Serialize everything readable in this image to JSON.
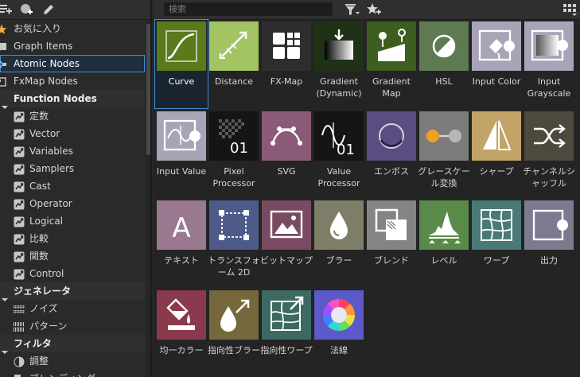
{
  "left_toolbar": {
    "icons": [
      "add-library-icon",
      "add-item-icon",
      "edit-icon"
    ]
  },
  "library": {
    "items": [
      {
        "label": "お気に入り",
        "icon": "star-icon",
        "kind": "lib"
      },
      {
        "label": "Graph Items",
        "icon": "graph-items-icon",
        "kind": "lib"
      },
      {
        "label": "Atomic Nodes",
        "icon": "atomic-nodes-icon",
        "kind": "lib",
        "selected": true
      },
      {
        "label": "FxMap Nodes",
        "icon": "fxmap-nodes-icon",
        "kind": "lib"
      },
      {
        "label": "Function Nodes",
        "icon": "collapse-arrow-icon",
        "kind": "section"
      },
      {
        "label": "定数",
        "icon": "function-icon",
        "kind": "sub"
      },
      {
        "label": "Vector",
        "icon": "function-icon",
        "kind": "sub"
      },
      {
        "label": "Variables",
        "icon": "function-icon",
        "kind": "sub"
      },
      {
        "label": "Samplers",
        "icon": "function-icon",
        "kind": "sub"
      },
      {
        "label": "Cast",
        "icon": "function-icon",
        "kind": "sub"
      },
      {
        "label": "Operator",
        "icon": "function-icon",
        "kind": "sub"
      },
      {
        "label": "Logical",
        "icon": "function-icon",
        "kind": "sub"
      },
      {
        "label": "比較",
        "icon": "function-icon",
        "kind": "sub"
      },
      {
        "label": "関数",
        "icon": "function-icon",
        "kind": "sub"
      },
      {
        "label": "Control",
        "icon": "function-icon",
        "kind": "sub"
      },
      {
        "label": "ジェネレータ",
        "icon": "collapse-arrow-icon",
        "kind": "section"
      },
      {
        "label": "ノイズ",
        "icon": "noise-icon",
        "kind": "sub"
      },
      {
        "label": "パターン",
        "icon": "pattern-icon",
        "kind": "sub"
      },
      {
        "label": "フィルタ",
        "icon": "collapse-arrow-icon",
        "kind": "section"
      },
      {
        "label": "調整",
        "icon": "adjust-icon",
        "kind": "sub"
      },
      {
        "label": "ブレンディング",
        "icon": "blending-icon",
        "kind": "sub"
      }
    ]
  },
  "right_toolbar": {
    "search_placeholder": "検索",
    "icons": [
      "filter-icon",
      "favorites-filter-icon",
      "view-mode-icon"
    ]
  },
  "nodes": [
    {
      "label": "Curve",
      "icon": "curve-icon",
      "bg": "#5a7a1c",
      "selected": true
    },
    {
      "label": "Distance",
      "icon": "distance-icon",
      "bg": "#a2c462"
    },
    {
      "label": "FX-Map",
      "icon": "fx-map-icon",
      "bg": "#2e2e2e"
    },
    {
      "label": "Gradient (Dynamic)",
      "icon": "gradient-dynamic-icon",
      "bg": "#1f3217"
    },
    {
      "label": "Gradient Map",
      "icon": "gradient-map-icon",
      "bg": "#3c5e1e"
    },
    {
      "label": "HSL",
      "icon": "hsl-icon",
      "bg": "#5d7a50"
    },
    {
      "label": "Input Color",
      "icon": "input-color-icon",
      "bg": "#a8a4b8"
    },
    {
      "label": "Input Grayscale",
      "icon": "input-grayscale-icon",
      "bg": "#a8a4b8"
    },
    {
      "label": "Input Value",
      "icon": "input-value-icon",
      "bg": "#a8a4b8"
    },
    {
      "label": "Pixel Processor",
      "icon": "pixel-processor-icon",
      "bg": "#151515",
      "badge": "01"
    },
    {
      "label": "SVG",
      "icon": "svg-icon",
      "bg": "#8a5a78"
    },
    {
      "label": "Value Processor",
      "icon": "value-processor-icon",
      "bg": "#151515",
      "badge": "01"
    },
    {
      "label": "エンボス",
      "icon": "emboss-icon",
      "bg": "#5a4d80"
    },
    {
      "label": "グレースケール変換",
      "icon": "grayscale-conversion-icon",
      "bg": "#7c7c7c"
    },
    {
      "label": "シャープ",
      "icon": "sharpen-icon",
      "bg": "#c2a468"
    },
    {
      "label": "チャンネルシャッフル",
      "icon": "channel-shuffle-icon",
      "bg": "#4c4a3c"
    },
    {
      "label": "テキスト",
      "icon": "text-icon",
      "bg": "#9a7890"
    },
    {
      "label": "トランスフォーム 2D",
      "icon": "transform-2d-icon",
      "bg": "#4d5a8a"
    },
    {
      "label": "ビットマップ",
      "icon": "bitmap-icon",
      "bg": "#7a4a62"
    },
    {
      "label": "ブラー",
      "icon": "blur-icon",
      "bg": "#7e7e68"
    },
    {
      "label": "ブレンド",
      "icon": "blend-icon",
      "bg": "#848484"
    },
    {
      "label": "レベル",
      "icon": "levels-icon",
      "bg": "#5a8a4a"
    },
    {
      "label": "ワープ",
      "icon": "warp-icon",
      "bg": "#4a7a78"
    },
    {
      "label": "出力",
      "icon": "output-icon",
      "bg": "#7c7a8e"
    },
    {
      "label": "均一カラー",
      "icon": "uniform-color-icon",
      "bg": "#8a3a4c"
    },
    {
      "label": "指向性ブラー",
      "icon": "directional-blur-icon",
      "bg": "#74683c"
    },
    {
      "label": "指向性ワープ",
      "icon": "directional-warp-icon",
      "bg": "#3c6a62"
    },
    {
      "label": "法線",
      "icon": "normal-icon",
      "bg": "#5c5ac8"
    }
  ]
}
